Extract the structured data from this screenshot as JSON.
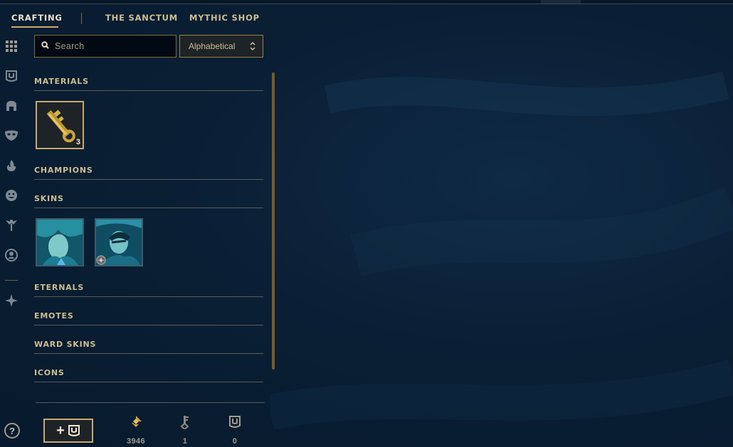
{
  "nav": {
    "tabs": [
      {
        "label": "CRAFTING",
        "active": true
      },
      {
        "label": "THE SANCTUM",
        "active": false
      },
      {
        "label": "MYTHIC SHOP",
        "active": false
      }
    ]
  },
  "rail": {
    "icons": [
      "grid-icon",
      "chest-icon",
      "helmet-icon",
      "mask-icon",
      "flame-icon",
      "emote-face-icon",
      "ward-icon",
      "profile-icon",
      "loot-star-icon"
    ]
  },
  "search": {
    "placeholder": "Search",
    "value": ""
  },
  "sort": {
    "selected": "Alphabetical"
  },
  "sections": {
    "materials": "MATERIALS",
    "champions": "CHAMPIONS",
    "skins": "SKINS",
    "eternals": "ETERNALS",
    "emotes": "EMOTES",
    "ward_skins": "WARD SKINS",
    "icons": "ICONS"
  },
  "materials": [
    {
      "icon": "hextech-key-fragment-icon",
      "count": "3"
    }
  ],
  "skins": [
    {
      "icon": "skin-portrait-1",
      "badge": "blue-essence-triangle"
    },
    {
      "icon": "skin-portrait-2",
      "badge": "token-round"
    }
  ],
  "footer": {
    "add_label": "+",
    "currencies": [
      {
        "icon": "blue-essence-icon",
        "value": "3946"
      },
      {
        "icon": "key-icon",
        "value": "1"
      },
      {
        "icon": "chest-icon",
        "value": "0"
      }
    ],
    "help_label": "?"
  },
  "colors": {
    "gold": "#c8aa6e",
    "text_gold": "#cdbe91",
    "bg": "#0a1f35"
  }
}
